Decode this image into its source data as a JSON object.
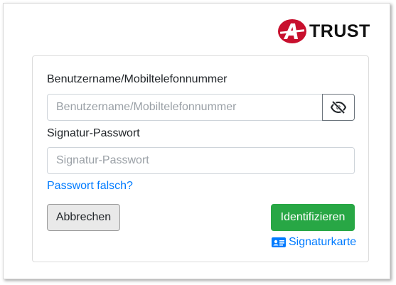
{
  "brand": {
    "name": "TRUST",
    "logo_letter": "A",
    "color": "#c8102e"
  },
  "form": {
    "username_label": "Benutzername/Mobiltelefonnummer",
    "username_placeholder": "Benutzername/Mobiltelefonnummer",
    "username_value": "",
    "password_label": "Signatur-Passwort",
    "password_placeholder": "Signatur-Passwort",
    "password_value": "",
    "toggle_icon": "eye-slash-icon",
    "forgot_link": "Passwort falsch?",
    "cancel_label": "Abbrechen",
    "submit_label": "Identifizieren",
    "signature_card_link": "Signaturkarte",
    "signature_card_icon": "id-card-icon"
  },
  "colors": {
    "link": "#007bff",
    "submit": "#28a745",
    "cancel_bg": "#e9e9e9"
  }
}
